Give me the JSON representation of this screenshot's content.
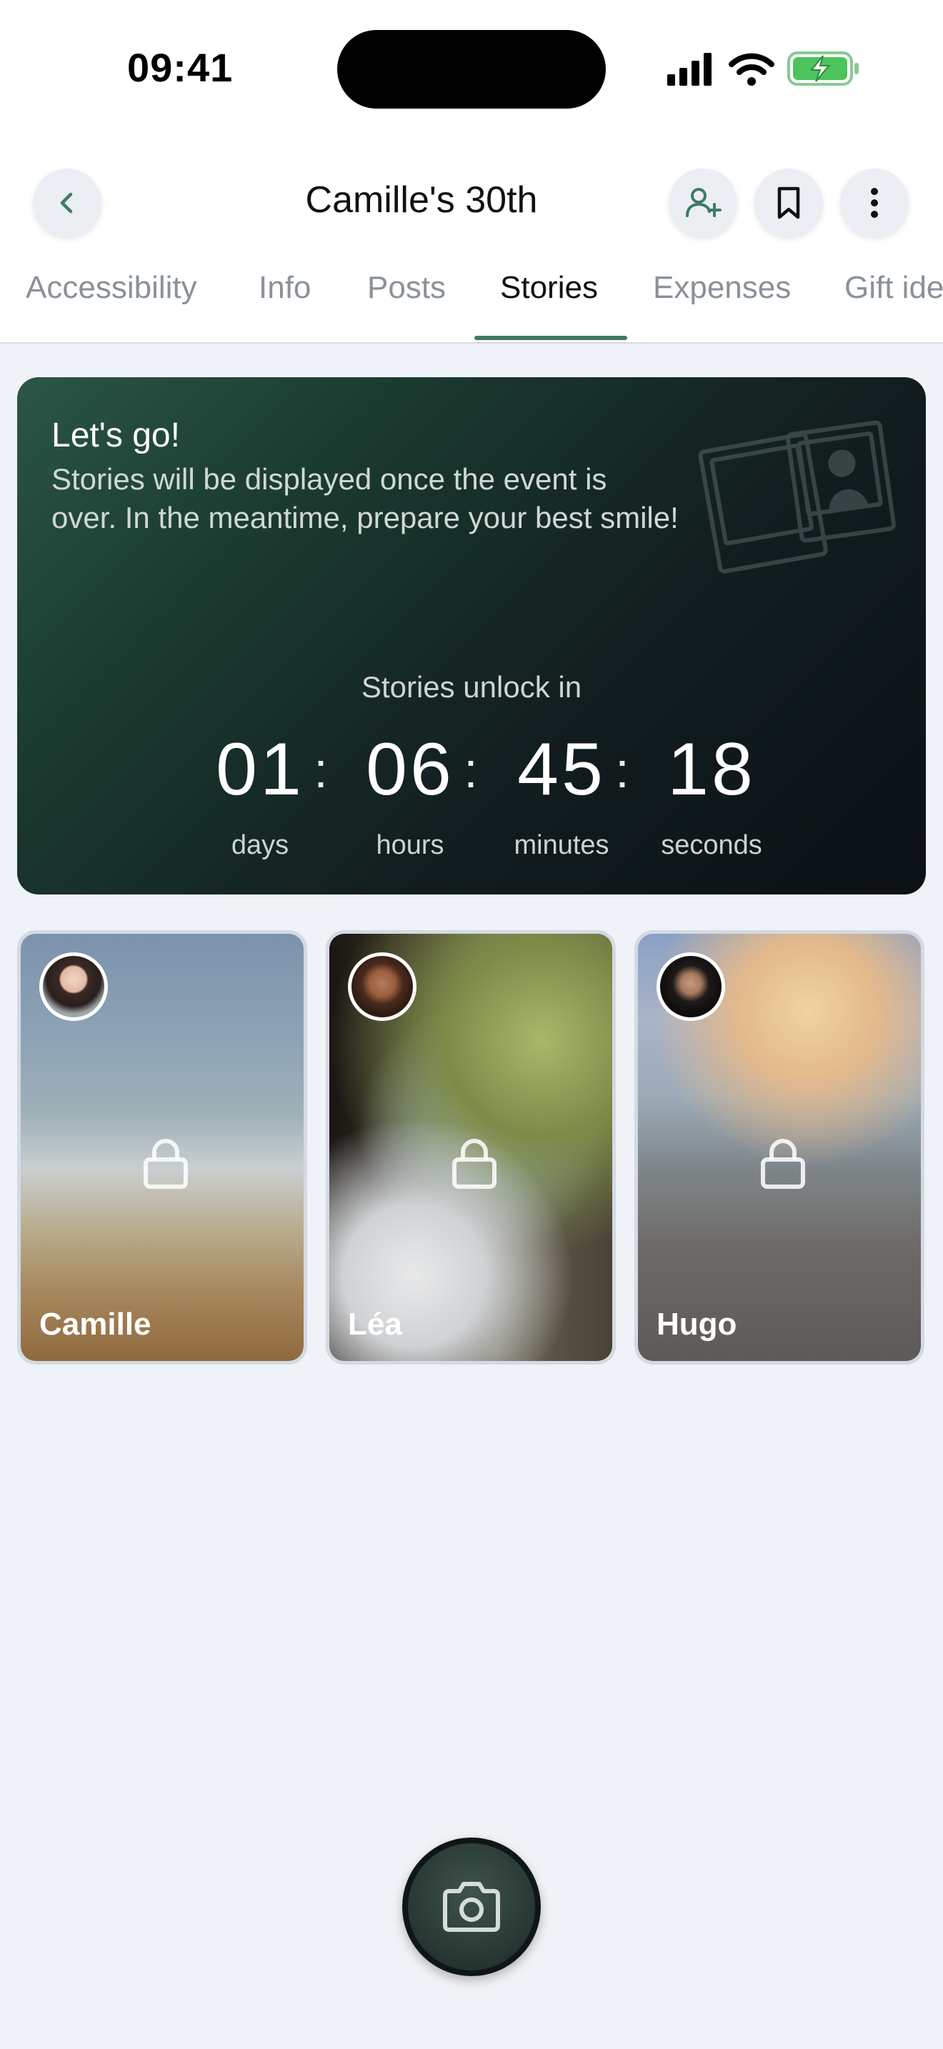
{
  "status_bar": {
    "time": "09:41"
  },
  "header": {
    "title": "Camille's 30th"
  },
  "tabs": [
    {
      "label": "Accessibility"
    },
    {
      "label": "Info"
    },
    {
      "label": "Posts"
    },
    {
      "label": "Stories"
    },
    {
      "label": "Expenses"
    },
    {
      "label": "Gift ide"
    }
  ],
  "active_tab": "Stories",
  "card": {
    "title": "Let's go!",
    "text": "Stories will be displayed once the event is over. In the meantime, prepare your best smile!",
    "unlock_label": "Stories unlock in",
    "countdown": {
      "days": "01",
      "hours": "06",
      "minutes": "45",
      "seconds": "18",
      "separator": ":",
      "units": {
        "days": "days",
        "hours": "hours",
        "minutes": "minutes",
        "seconds": "seconds"
      }
    }
  },
  "stories": [
    {
      "name": "Camille"
    },
    {
      "name": "Léa"
    },
    {
      "name": "Hugo"
    }
  ],
  "colors": {
    "accent": "#3f7a66",
    "background": "#eff2f6",
    "card_dark": "#0b1115"
  }
}
